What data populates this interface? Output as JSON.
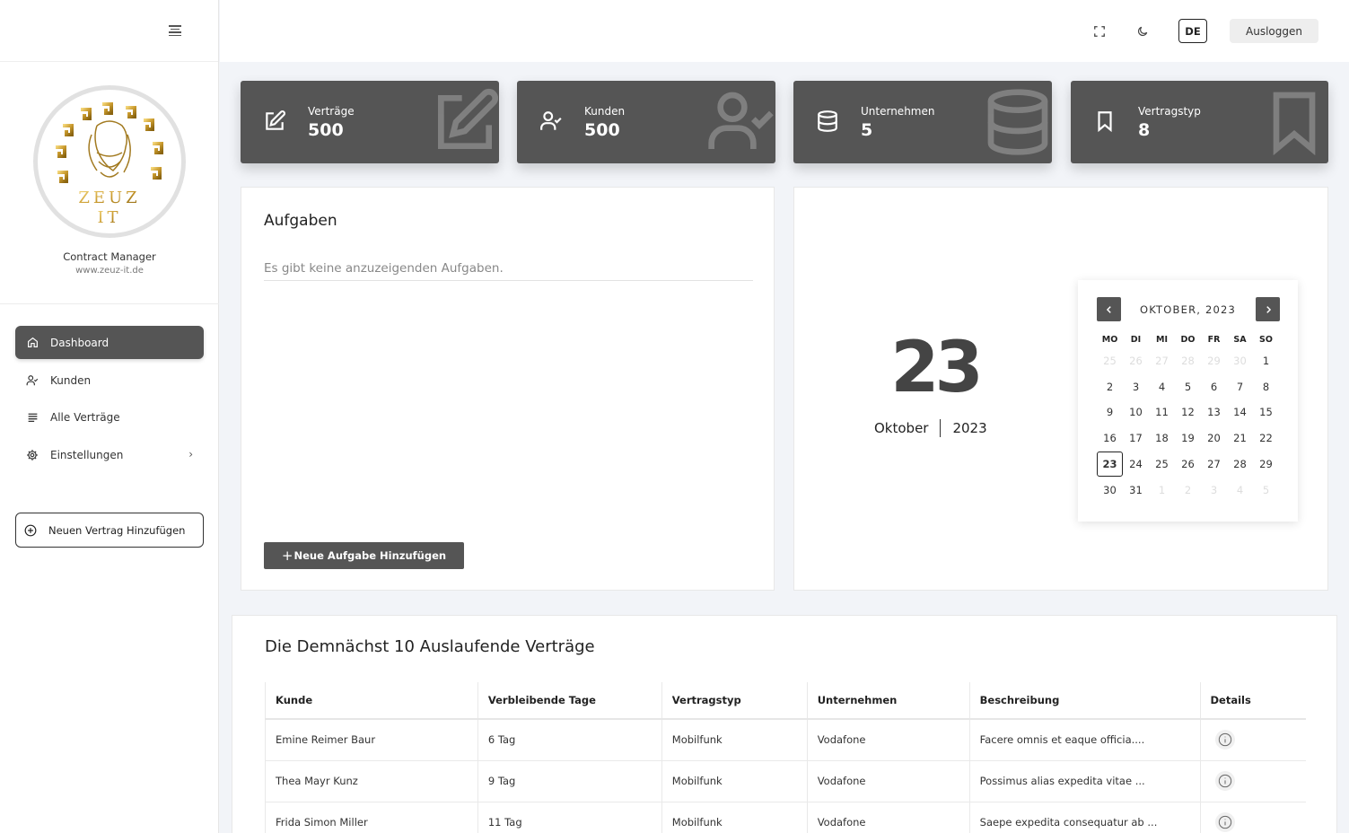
{
  "sidebar": {
    "app_name": "Contract Manager",
    "app_url": "www.zeuz-it.de",
    "logo_text": "ZEUZ IT",
    "nav": [
      {
        "label": "Dashboard",
        "icon": "home-icon",
        "active": true
      },
      {
        "label": "Kunden",
        "icon": "user-check-icon"
      },
      {
        "label": "Alle Verträge",
        "icon": "list-icon"
      },
      {
        "label": "Einstellungen",
        "icon": "gear-icon"
      }
    ],
    "add_contract_label": "Neuen Vertrag Hinzufügen"
  },
  "header": {
    "language": "DE",
    "logout_label": "Ausloggen"
  },
  "stats": [
    {
      "label": "Verträge",
      "value": "500",
      "icon": "edit-icon"
    },
    {
      "label": "Kunden",
      "value": "500",
      "icon": "user-check-icon"
    },
    {
      "label": "Unternehmen",
      "value": "5",
      "icon": "database-icon"
    },
    {
      "label": "Vertragstyp",
      "value": "8",
      "icon": "bookmark-icon"
    }
  ],
  "tasks": {
    "title": "Aufgaben",
    "empty_text": "Es gibt keine anzuzeigenden Aufgaben.",
    "add_button": "Neue Aufgabe Hinzufügen"
  },
  "date": {
    "day": "23",
    "month": "Oktober",
    "year": "2023"
  },
  "calendar": {
    "title": "OKTOBER, 2023",
    "weekdays": [
      "MO",
      "DI",
      "MI",
      "DO",
      "FR",
      "SA",
      "SO"
    ],
    "weeks": [
      [
        "25",
        "26",
        "27",
        "28",
        "29",
        "30",
        "1"
      ],
      [
        "2",
        "3",
        "4",
        "5",
        "6",
        "7",
        "8"
      ],
      [
        "9",
        "10",
        "11",
        "12",
        "13",
        "14",
        "15"
      ],
      [
        "16",
        "17",
        "18",
        "19",
        "20",
        "21",
        "22"
      ],
      [
        "23",
        "24",
        "25",
        "26",
        "27",
        "28",
        "29"
      ],
      [
        "30",
        "31",
        "1",
        "2",
        "3",
        "4",
        "5"
      ]
    ],
    "today": "23"
  },
  "contracts": {
    "title": "Die Demnächst 10 Auslaufende Verträge",
    "columns": [
      "Kunde",
      "Verbleibende Tage",
      "Vertragstyp",
      "Unternehmen",
      "Beschreibung",
      "Details"
    ],
    "rows": [
      [
        "Emine Reimer Baur",
        "6 Tag",
        "Mobilfunk",
        "Vodafone",
        "Facere omnis et eaque officia...."
      ],
      [
        "Thea Mayr Kunz",
        "9 Tag",
        "Mobilfunk",
        "Vodafone",
        "Possimus alias expedita vitae ..."
      ],
      [
        "Frida Simon Miller",
        "11 Tag",
        "Mobilfunk",
        "Vodafone",
        "Saepe expedita consequatur ab ..."
      ]
    ]
  }
}
